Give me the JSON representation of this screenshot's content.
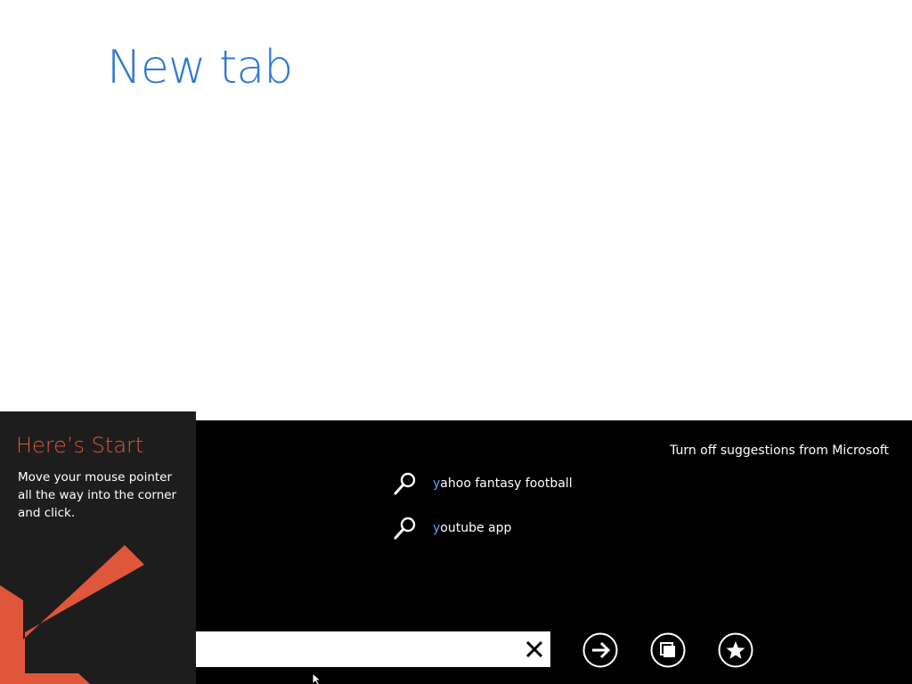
{
  "page": {
    "title": "New tab"
  },
  "appbar": {
    "turn_off_suggestions": "Turn off suggestions from Microsoft",
    "suggestions": [
      {
        "highlight": "y",
        "rest": "ahoo fantasy football",
        "icon": "search-icon"
      },
      {
        "highlight": "y",
        "rest": "outube app",
        "icon": "search-icon"
      }
    ],
    "address_bar": {
      "value": "",
      "placeholder": ""
    },
    "buttons": {
      "clear_icon": "close-icon",
      "go_icon": "arrow-right-icon",
      "tabs_icon": "tabs-icon",
      "favorite_icon": "star-icon"
    }
  },
  "start_tip": {
    "title": "Here’s Start",
    "body": "Move your mouse pointer all the way into the corner and click.",
    "arrow_icon": "arrow-down-left-icon"
  },
  "colors": {
    "title_blue": "#2f7bd3",
    "accent_orange": "#e0563a",
    "highlight_blue": "#4aa3ff",
    "appbar_bg": "#000000",
    "tip_bg": "#1d1d1d"
  }
}
